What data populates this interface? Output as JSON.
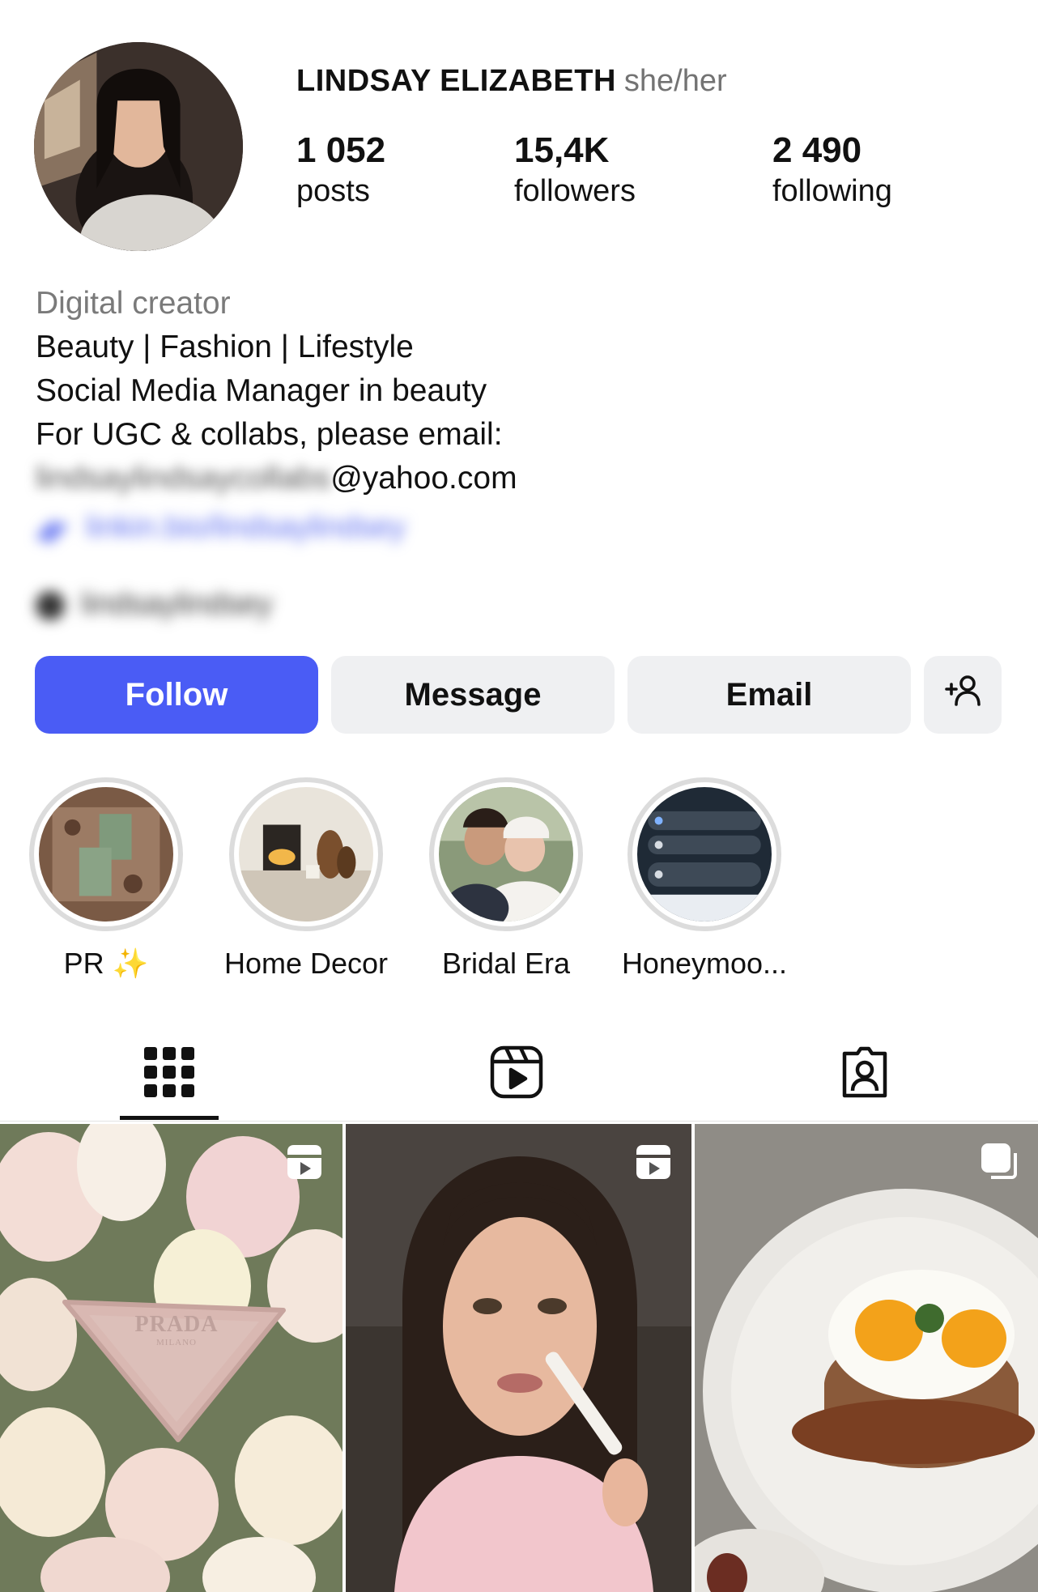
{
  "profile": {
    "username": "LINDSAY ELIZABETH",
    "pronouns": "she/her"
  },
  "stats": {
    "posts": {
      "value": "1 052",
      "label": "posts"
    },
    "followers": {
      "value": "15,4K",
      "label": "followers"
    },
    "following": {
      "value": "2 490",
      "label": "following"
    }
  },
  "bio": {
    "category": "Digital creator",
    "lines": [
      "Beauty | Fashion | Lifestyle",
      "Social Media Manager in beauty",
      "For UGC & collabs, please email:"
    ],
    "email_visible_part": "@yahoo.com"
  },
  "buttons": {
    "follow": "Follow",
    "message": "Message",
    "email": "Email"
  },
  "highlights": [
    {
      "label": "PR",
      "emoji": "✨"
    },
    {
      "label": "Home Decor"
    },
    {
      "label": "Bridal Era"
    },
    {
      "label": "Honeymoo..."
    }
  ],
  "colors": {
    "primary": "#4a5cf5",
    "secondary_button": "#eff0f2",
    "muted_text": "#737373"
  },
  "icons": {
    "add_user": "person-add-icon",
    "tab_grid": "grid-icon",
    "tab_reels": "reels-icon",
    "tab_tagged": "tagged-icon",
    "post_1_badge": "reel-badge-icon",
    "post_2_badge": "reel-badge-icon",
    "post_3_badge": "carousel-badge-icon"
  },
  "posts": [
    {
      "logo_text": "PRADA",
      "logo_subtext": "MILANO"
    },
    {},
    {}
  ]
}
